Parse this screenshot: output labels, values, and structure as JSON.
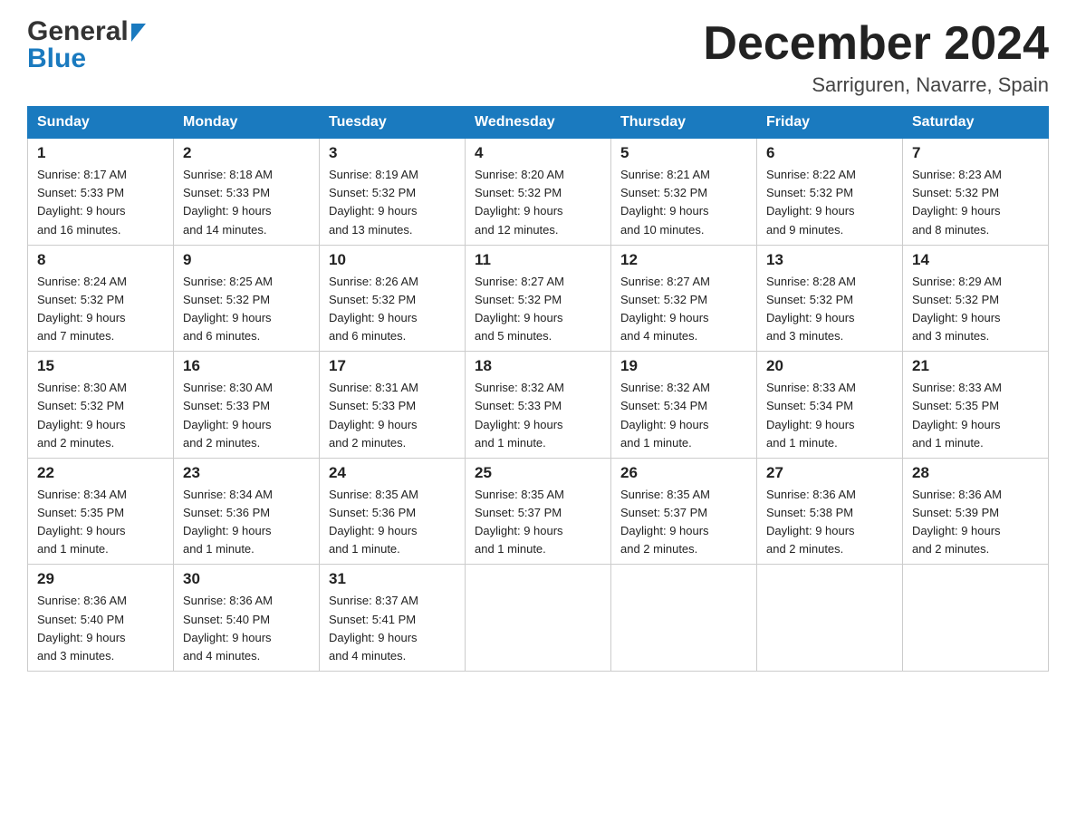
{
  "header": {
    "month_title": "December 2024",
    "location": "Sarriguren, Navarre, Spain",
    "logo_general": "General",
    "logo_blue": "Blue"
  },
  "days_of_week": [
    "Sunday",
    "Monday",
    "Tuesday",
    "Wednesday",
    "Thursday",
    "Friday",
    "Saturday"
  ],
  "weeks": [
    [
      {
        "day": "1",
        "sunrise": "8:17 AM",
        "sunset": "5:33 PM",
        "daylight": "9 hours and 16 minutes."
      },
      {
        "day": "2",
        "sunrise": "8:18 AM",
        "sunset": "5:33 PM",
        "daylight": "9 hours and 14 minutes."
      },
      {
        "day": "3",
        "sunrise": "8:19 AM",
        "sunset": "5:32 PM",
        "daylight": "9 hours and 13 minutes."
      },
      {
        "day": "4",
        "sunrise": "8:20 AM",
        "sunset": "5:32 PM",
        "daylight": "9 hours and 12 minutes."
      },
      {
        "day": "5",
        "sunrise": "8:21 AM",
        "sunset": "5:32 PM",
        "daylight": "9 hours and 10 minutes."
      },
      {
        "day": "6",
        "sunrise": "8:22 AM",
        "sunset": "5:32 PM",
        "daylight": "9 hours and 9 minutes."
      },
      {
        "day": "7",
        "sunrise": "8:23 AM",
        "sunset": "5:32 PM",
        "daylight": "9 hours and 8 minutes."
      }
    ],
    [
      {
        "day": "8",
        "sunrise": "8:24 AM",
        "sunset": "5:32 PM",
        "daylight": "9 hours and 7 minutes."
      },
      {
        "day": "9",
        "sunrise": "8:25 AM",
        "sunset": "5:32 PM",
        "daylight": "9 hours and 6 minutes."
      },
      {
        "day": "10",
        "sunrise": "8:26 AM",
        "sunset": "5:32 PM",
        "daylight": "9 hours and 6 minutes."
      },
      {
        "day": "11",
        "sunrise": "8:27 AM",
        "sunset": "5:32 PM",
        "daylight": "9 hours and 5 minutes."
      },
      {
        "day": "12",
        "sunrise": "8:27 AM",
        "sunset": "5:32 PM",
        "daylight": "9 hours and 4 minutes."
      },
      {
        "day": "13",
        "sunrise": "8:28 AM",
        "sunset": "5:32 PM",
        "daylight": "9 hours and 3 minutes."
      },
      {
        "day": "14",
        "sunrise": "8:29 AM",
        "sunset": "5:32 PM",
        "daylight": "9 hours and 3 minutes."
      }
    ],
    [
      {
        "day": "15",
        "sunrise": "8:30 AM",
        "sunset": "5:32 PM",
        "daylight": "9 hours and 2 minutes."
      },
      {
        "day": "16",
        "sunrise": "8:30 AM",
        "sunset": "5:33 PM",
        "daylight": "9 hours and 2 minutes."
      },
      {
        "day": "17",
        "sunrise": "8:31 AM",
        "sunset": "5:33 PM",
        "daylight": "9 hours and 2 minutes."
      },
      {
        "day": "18",
        "sunrise": "8:32 AM",
        "sunset": "5:33 PM",
        "daylight": "9 hours and 1 minute."
      },
      {
        "day": "19",
        "sunrise": "8:32 AM",
        "sunset": "5:34 PM",
        "daylight": "9 hours and 1 minute."
      },
      {
        "day": "20",
        "sunrise": "8:33 AM",
        "sunset": "5:34 PM",
        "daylight": "9 hours and 1 minute."
      },
      {
        "day": "21",
        "sunrise": "8:33 AM",
        "sunset": "5:35 PM",
        "daylight": "9 hours and 1 minute."
      }
    ],
    [
      {
        "day": "22",
        "sunrise": "8:34 AM",
        "sunset": "5:35 PM",
        "daylight": "9 hours and 1 minute."
      },
      {
        "day": "23",
        "sunrise": "8:34 AM",
        "sunset": "5:36 PM",
        "daylight": "9 hours and 1 minute."
      },
      {
        "day": "24",
        "sunrise": "8:35 AM",
        "sunset": "5:36 PM",
        "daylight": "9 hours and 1 minute."
      },
      {
        "day": "25",
        "sunrise": "8:35 AM",
        "sunset": "5:37 PM",
        "daylight": "9 hours and 1 minute."
      },
      {
        "day": "26",
        "sunrise": "8:35 AM",
        "sunset": "5:37 PM",
        "daylight": "9 hours and 2 minutes."
      },
      {
        "day": "27",
        "sunrise": "8:36 AM",
        "sunset": "5:38 PM",
        "daylight": "9 hours and 2 minutes."
      },
      {
        "day": "28",
        "sunrise": "8:36 AM",
        "sunset": "5:39 PM",
        "daylight": "9 hours and 2 minutes."
      }
    ],
    [
      {
        "day": "29",
        "sunrise": "8:36 AM",
        "sunset": "5:40 PM",
        "daylight": "9 hours and 3 minutes."
      },
      {
        "day": "30",
        "sunrise": "8:36 AM",
        "sunset": "5:40 PM",
        "daylight": "9 hours and 4 minutes."
      },
      {
        "day": "31",
        "sunrise": "8:37 AM",
        "sunset": "5:41 PM",
        "daylight": "9 hours and 4 minutes."
      },
      null,
      null,
      null,
      null
    ]
  ],
  "labels": {
    "sunrise": "Sunrise:",
    "sunset": "Sunset:",
    "daylight": "Daylight:"
  },
  "colors": {
    "header_bg": "#1a7abf",
    "header_text": "#ffffff",
    "border": "#cccccc"
  }
}
